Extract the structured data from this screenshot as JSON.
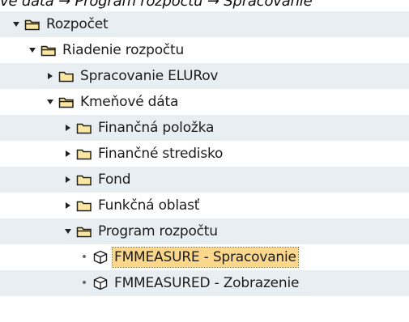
{
  "breadcrumb": "ve dáta → Program rozpočtu → Spracovanie",
  "tree": {
    "nodes": [
      {
        "label": "Rozpočet",
        "state": "expanded",
        "type": "folder-open",
        "level": 0
      },
      {
        "label": "Riadenie rozpočtu",
        "state": "expanded",
        "type": "folder-open",
        "level": 1
      },
      {
        "label": "Spracovanie ELURov",
        "state": "collapsed",
        "type": "folder",
        "level": 2
      },
      {
        "label": "Kmeňové dáta",
        "state": "expanded",
        "type": "folder-open",
        "level": 2
      },
      {
        "label": "Finančná položka",
        "state": "collapsed",
        "type": "folder",
        "level": 3
      },
      {
        "label": "Finančné stredisko",
        "state": "collapsed",
        "type": "folder",
        "level": 3
      },
      {
        "label": "Fond",
        "state": "collapsed",
        "type": "folder",
        "level": 3
      },
      {
        "label": "Funkčná oblasť",
        "state": "collapsed",
        "type": "folder",
        "level": 3
      },
      {
        "label": "Program rozpočtu",
        "state": "expanded",
        "type": "folder-open",
        "level": 3
      },
      {
        "label": "FMMEASURE - Spracovanie",
        "state": "leaf",
        "type": "transaction",
        "level": 4,
        "selected": true
      },
      {
        "label": "FMMEASURED - Zobrazenie",
        "state": "leaf",
        "type": "transaction",
        "level": 4
      }
    ]
  },
  "colors": {
    "row_alt": "#e9eef3",
    "selection": "#fbd78b",
    "folder_fill": "#fbe7a1",
    "folder_stroke": "#1f1f1f"
  }
}
